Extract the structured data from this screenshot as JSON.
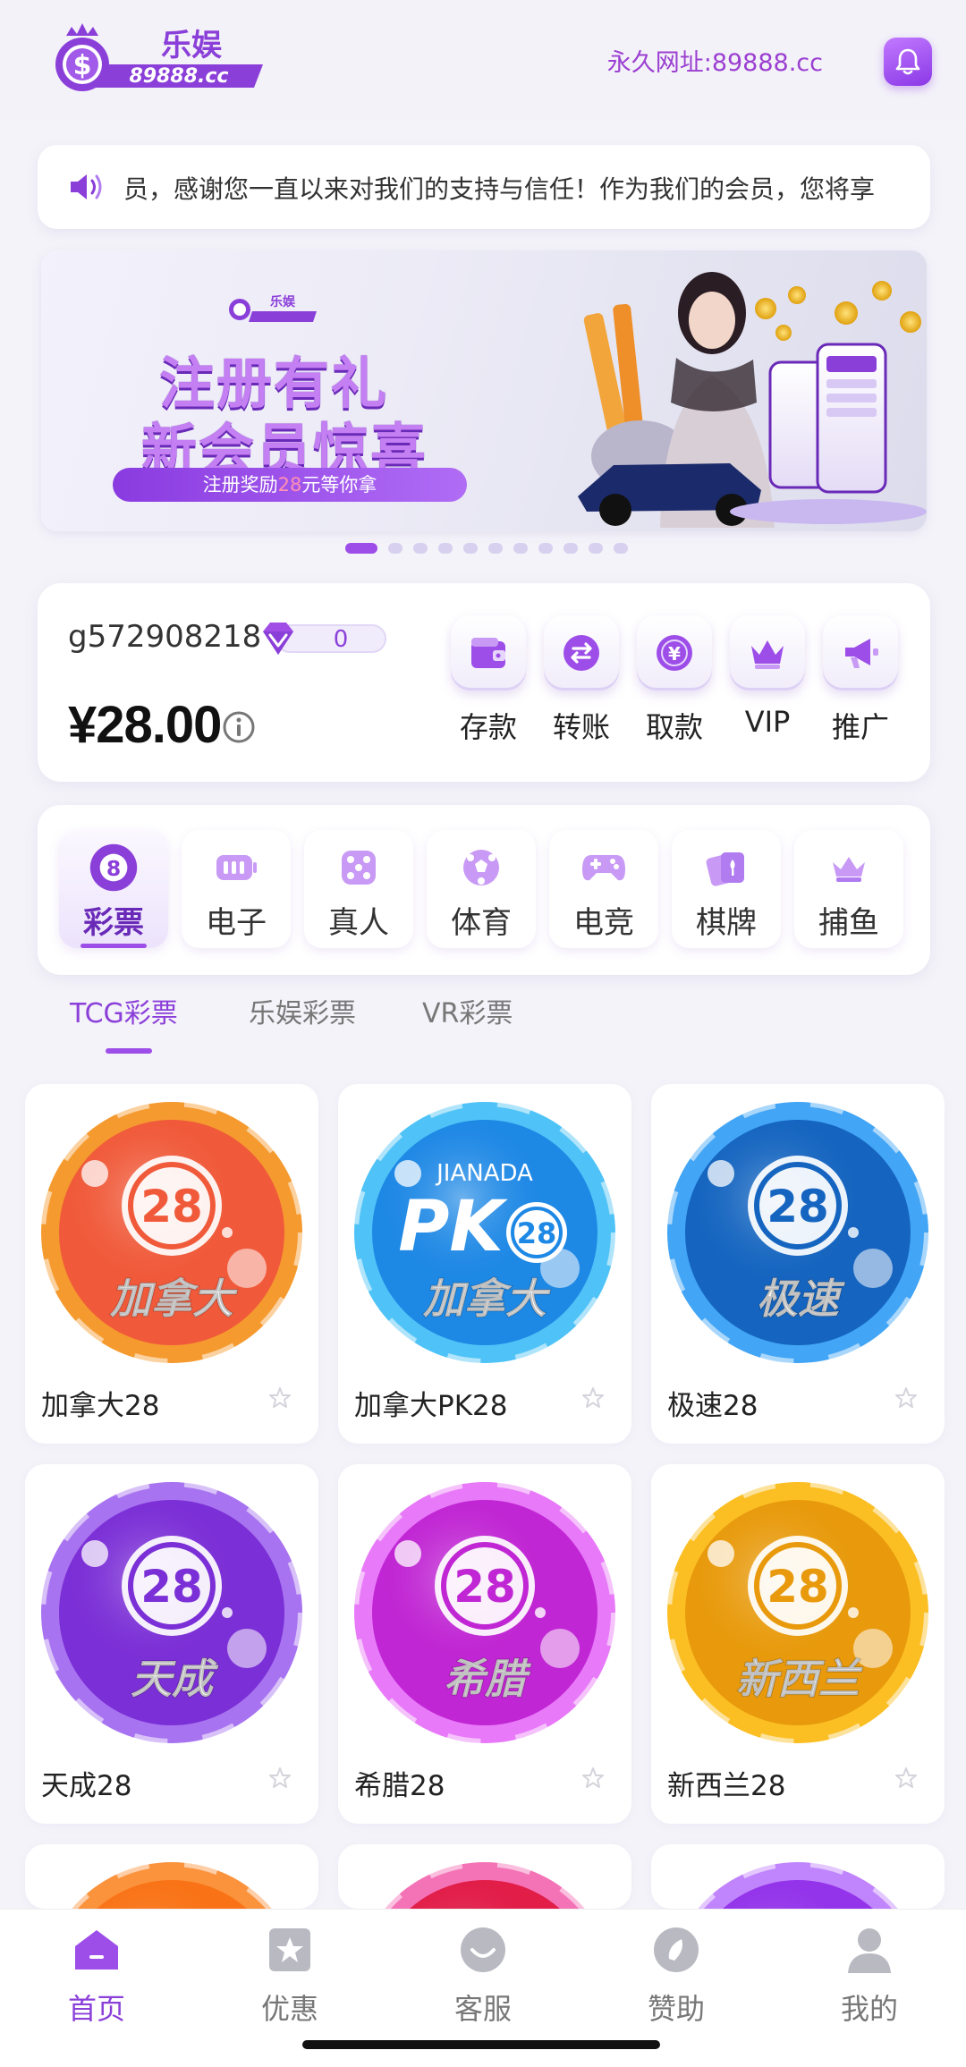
{
  "header": {
    "logo_text": "乐娱",
    "logo_domain": "89888.cc",
    "permanent_url": "永久网址:89888.cc",
    "bell_icon": "bell-icon"
  },
  "notice": {
    "icon": "speaker-icon",
    "text": "员，感谢您一直以来对我们的支持与信任！作为我们的会员，您将享"
  },
  "banner": {
    "logo_text": "乐娱",
    "title_line1": "注册有礼",
    "title_line2": "新会员惊喜",
    "pill_prefix": "注册奖励",
    "pill_highlight": "28",
    "pill_suffix": "元等你拿",
    "slide_count": 11,
    "active_slide": 0
  },
  "account": {
    "username": "g572908218",
    "vip_level": "0",
    "balance": "¥28.00",
    "actions": [
      {
        "label": "存款",
        "icon": "wallet-icon"
      },
      {
        "label": "转账",
        "icon": "transfer-icon"
      },
      {
        "label": "取款",
        "icon": "withdraw-icon"
      },
      {
        "label": "VIP",
        "icon": "crown-icon"
      },
      {
        "label": "推广",
        "icon": "megaphone-icon"
      }
    ]
  },
  "categories": [
    {
      "label": "彩票",
      "icon": "lottery-ball-icon",
      "active": true
    },
    {
      "label": "电子",
      "icon": "battery-icon",
      "active": false
    },
    {
      "label": "真人",
      "icon": "dice-icon",
      "active": false
    },
    {
      "label": "体育",
      "icon": "soccer-ball-icon",
      "active": false
    },
    {
      "label": "电竞",
      "icon": "gamepad-icon",
      "active": false
    },
    {
      "label": "棋牌",
      "icon": "cards-icon",
      "active": false
    },
    {
      "label": "捕鱼",
      "icon": "crown-fish-icon",
      "active": false
    }
  ],
  "subtabs": [
    "TCG彩票",
    "乐娱彩票",
    "VR彩票"
  ],
  "games": [
    {
      "name": "加拿大28",
      "chip_top": "28",
      "chip_bottom": "加拿大",
      "color": "#f05a3a",
      "rim": "#f59a2e"
    },
    {
      "name": "加拿大PK28",
      "chip_top": "PK",
      "chip_bottom": "加拿大",
      "chip_sub": "JIANADA",
      "color": "#1e88e5",
      "rim": "#4fc3f7"
    },
    {
      "name": "极速28",
      "chip_top": "28",
      "chip_bottom": "极速",
      "color": "#1565c0",
      "rim": "#42a5f5"
    },
    {
      "name": "天成28",
      "chip_top": "28",
      "chip_bottom": "天成",
      "color": "#7b2fd6",
      "rim": "#a873f0"
    },
    {
      "name": "希腊28",
      "chip_top": "28",
      "chip_bottom": "希腊",
      "color": "#c026d3",
      "rim": "#e879f9"
    },
    {
      "name": "新西兰28",
      "chip_top": "28",
      "chip_bottom": "新西兰",
      "color": "#e89a0c",
      "rim": "#fbbf24"
    }
  ],
  "partial_games": [
    {
      "color": "#f97316",
      "rim": "#fb923c"
    },
    {
      "color": "#e11d48",
      "rim": "#f472b6"
    },
    {
      "color": "#9333ea",
      "rim": "#c084fc"
    }
  ],
  "nav": [
    {
      "label": "首页",
      "icon": "home-icon",
      "active": true
    },
    {
      "label": "优惠",
      "icon": "star-card-icon",
      "active": false
    },
    {
      "label": "客服",
      "icon": "support-icon",
      "active": false
    },
    {
      "label": "赞助",
      "icon": "sponsor-icon",
      "active": false
    },
    {
      "label": "我的",
      "icon": "user-icon",
      "active": false
    }
  ],
  "colors": {
    "accent": "#9d4ee8",
    "accent_text": "#8b3fd9",
    "background": "#f4f3f9"
  }
}
